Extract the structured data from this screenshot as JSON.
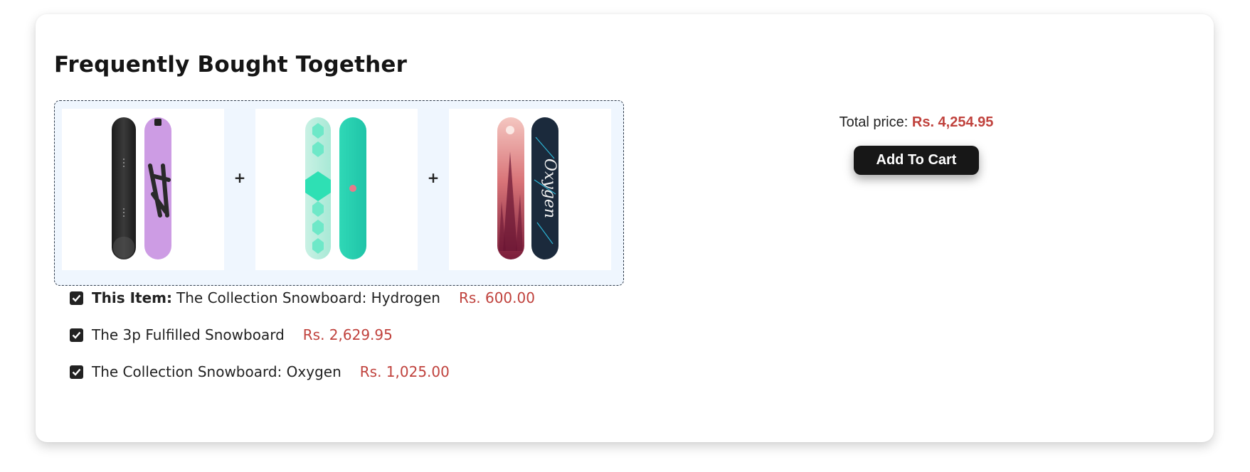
{
  "section": {
    "title": "Frequently Bought Together"
  },
  "bundle": {
    "products": [
      {
        "name": "The Collection Snowboard: Hydrogen",
        "image_icon": "snowboard-hydrogen-image"
      },
      {
        "name": "The 3p Fulfilled Snowboard",
        "image_icon": "snowboard-3p-fulfilled-image"
      },
      {
        "name": "The Collection Snowboard: Oxygen",
        "image_icon": "snowboard-oxygen-image"
      }
    ],
    "separator": "+"
  },
  "items": [
    {
      "checked": true,
      "prefix": "This Item:",
      "name": "The Collection Snowboard: Hydrogen",
      "price": "Rs. 600.00"
    },
    {
      "checked": true,
      "prefix": "",
      "name": "The 3p Fulfilled Snowboard",
      "price": "Rs. 2,629.95"
    },
    {
      "checked": true,
      "prefix": "",
      "name": "The Collection Snowboard: Oxygen",
      "price": "Rs. 1,025.00"
    }
  ],
  "summary": {
    "total_label": "Total price:",
    "total_value": "Rs. 4,254.95",
    "add_to_cart_label": "Add To Cart"
  },
  "colors": {
    "price": "#c0423d",
    "button_bg": "#171717",
    "bundle_bg": "#eff6fe"
  }
}
